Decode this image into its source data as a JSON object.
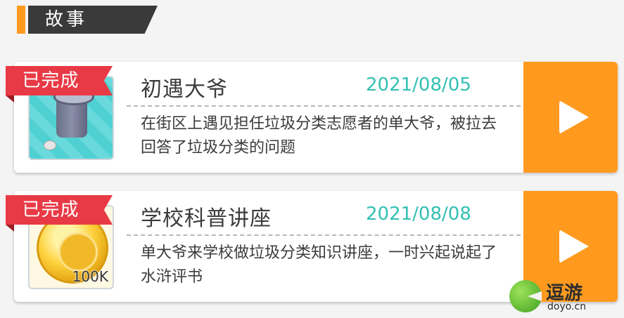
{
  "header": {
    "title": "故事"
  },
  "stories": [
    {
      "status": "已完成",
      "title": "初遇大爷",
      "date": "2021/08/05",
      "description": "在街区上遇见担任垃圾分类志愿者的单大爷，被拉去回答了垃圾分类的问题",
      "thumbnail_icon": "trash-bin-icon"
    },
    {
      "status": "已完成",
      "title": "学校科普讲座",
      "date": "2021/08/08",
      "description": "单大爷来学校做垃圾分类知识讲座，一时兴起说起了水浒评书",
      "thumbnail_icon": "gold-coin-icon",
      "reward_quantity": "100K"
    }
  ],
  "play_icon": "play-icon",
  "watermark": {
    "brand": "逗游",
    "url": "doyo.cn"
  },
  "colors": {
    "accent_orange": "#ff9a1f",
    "date_teal": "#33c0b3",
    "ribbon_red": "#e83a46"
  }
}
